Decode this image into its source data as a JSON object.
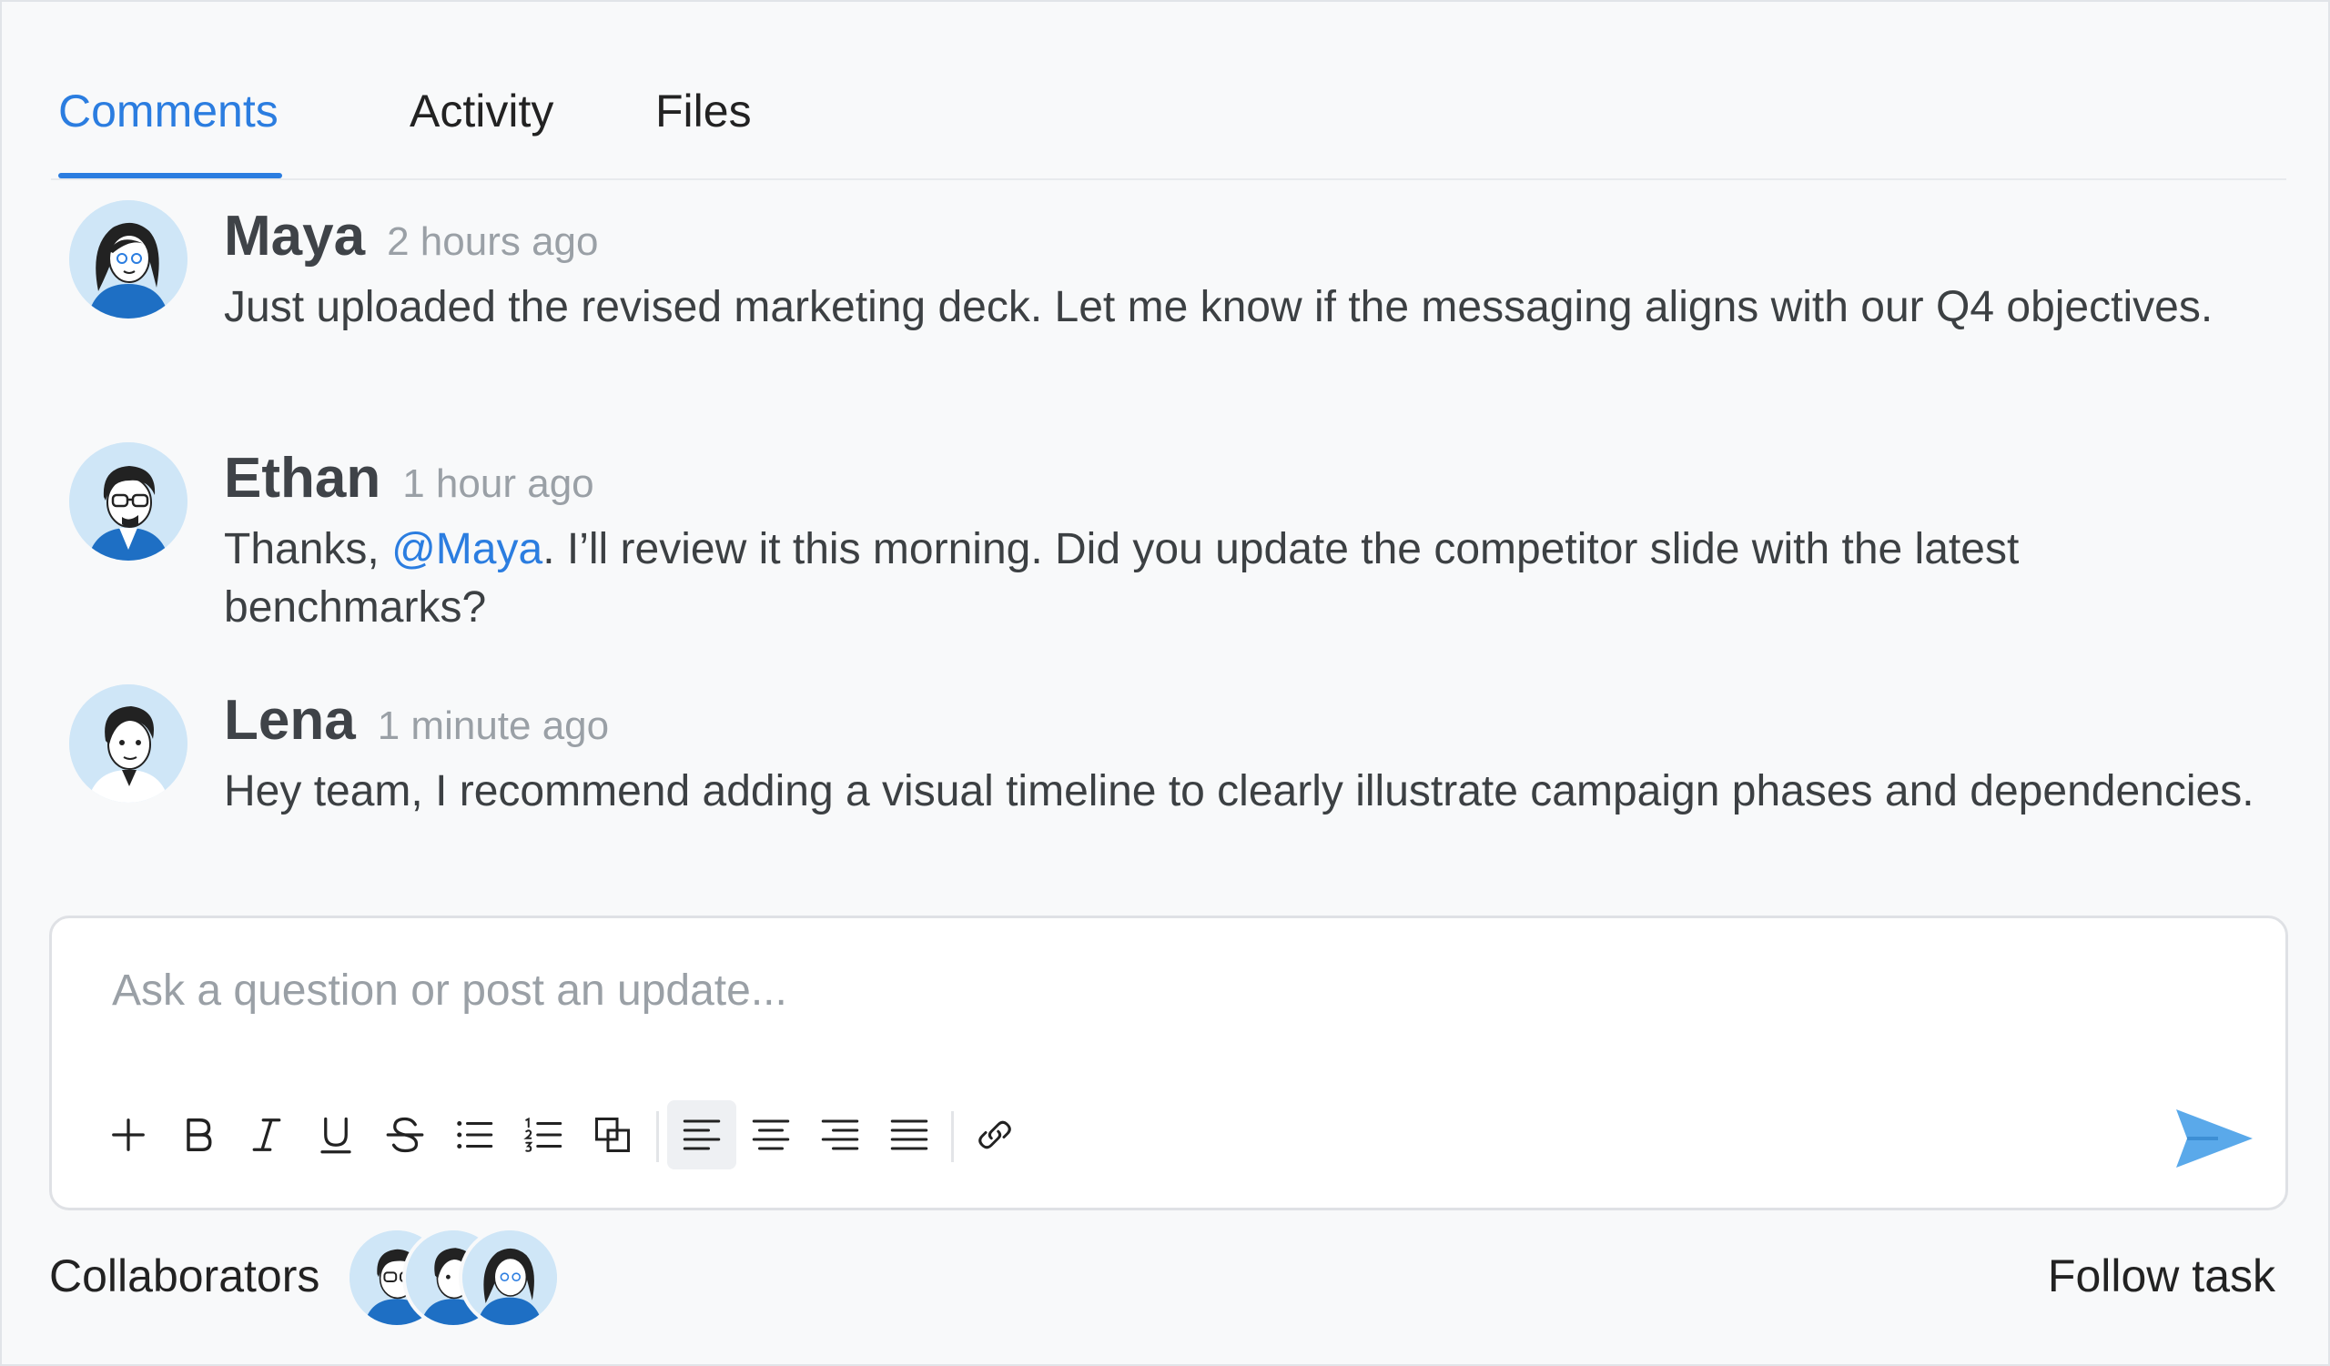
{
  "tabs": [
    {
      "label": "Comments",
      "active": true
    },
    {
      "label": "Activity",
      "active": false
    },
    {
      "label": "Files",
      "active": false
    }
  ],
  "comments": [
    {
      "author": "Maya",
      "time": "2 hours ago",
      "avatar": "woman-avatar-icon",
      "body": "Just uploaded the revised marketing deck. Let me know if the messaging aligns with our Q4 objectives."
    },
    {
      "author": "Ethan",
      "time": "1 hour ago",
      "avatar": "man-glasses-avatar-icon",
      "body_prefix": "Thanks, ",
      "mention": "@Maya",
      "body_suffix": ". I’ll review it this morning. Did you update the competitor slide with the latest benchmarks?"
    },
    {
      "author": "Lena",
      "time": "1 minute ago",
      "avatar": "person-avatar-icon",
      "body": "Hey team, I recommend adding a visual timeline to clearly illustrate campaign phases and dependencies."
    }
  ],
  "composer": {
    "placeholder": "Ask a question or post an update...",
    "tools": [
      "plus-icon",
      "bold-icon",
      "italic-icon",
      "underline-icon",
      "strikethrough-icon",
      "bullet-list-icon",
      "numbered-list-icon",
      "copy-block-icon",
      "align-left-icon",
      "align-center-icon",
      "align-right-icon",
      "align-justify-icon",
      "link-icon"
    ],
    "active_tool": "align-left-icon",
    "send_icon": "send-icon"
  },
  "footer": {
    "collaborators_label": "Collaborators",
    "collaborators": [
      "Ethan",
      "Lena",
      "Maya"
    ],
    "follow_label": "Follow task"
  },
  "colors": {
    "accent": "#2b7de0",
    "avatar_bg": "#cfe6f7",
    "send": "#5aa9ea"
  }
}
